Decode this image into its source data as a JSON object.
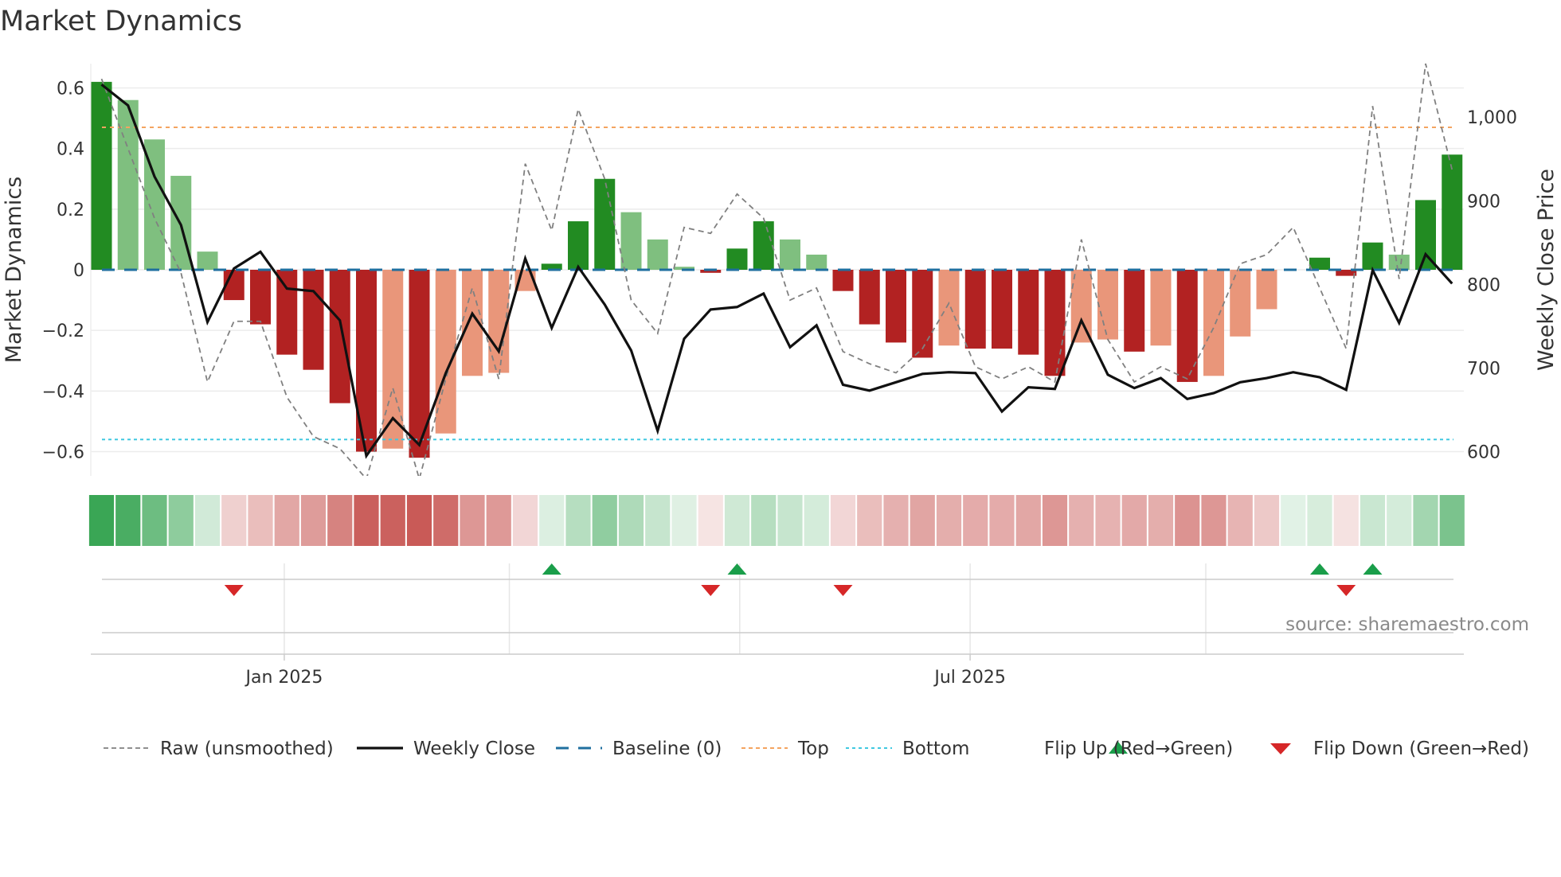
{
  "chart_data": {
    "type": "bar",
    "title": "Market Dynamics",
    "ylabel": "Market Dynamics",
    "y2label": "Weekly Close Price",
    "ylim": [
      -0.68,
      0.68
    ],
    "y2lim": [
      571,
      1064
    ],
    "yticks": [
      0.6,
      0.4,
      0.2,
      0,
      -0.2,
      -0.4,
      -0.6
    ],
    "ytick_labels": [
      "0.6",
      "0.4",
      "0.2",
      "0",
      "−0.2",
      "−0.4",
      "−0.6"
    ],
    "y2ticks": [
      1000,
      900,
      800,
      700,
      600
    ],
    "y2tick_labels": [
      "1,000",
      "900",
      "800",
      "700",
      "600"
    ],
    "xtick_labels": [
      {
        "label": "Jan 2025",
        "index": 6.9
      },
      {
        "label": "Jul 2025",
        "index": 32.8
      }
    ],
    "month_grid_indices": [
      6.9,
      15.4,
      24.1,
      32.8,
      41.7
    ],
    "dynamics": [
      0.62,
      0.56,
      0.43,
      0.31,
      0.06,
      -0.1,
      -0.18,
      -0.28,
      -0.33,
      -0.44,
      -0.6,
      -0.59,
      -0.62,
      -0.54,
      -0.35,
      -0.34,
      -0.07,
      0.02,
      0.16,
      0.3,
      0.19,
      0.1,
      0.01,
      -0.01,
      0.07,
      0.16,
      0.1,
      0.05,
      -0.07,
      -0.18,
      -0.24,
      -0.29,
      -0.25,
      -0.26,
      -0.26,
      -0.28,
      -0.35,
      -0.24,
      -0.23,
      -0.27,
      -0.25,
      -0.37,
      -0.35,
      -0.22,
      -0.13,
      0.0,
      0.04,
      -0.02,
      0.09,
      0.05,
      0.23,
      0.38
    ],
    "strength": [
      "S",
      "W",
      "W",
      "W",
      "W",
      "S",
      "S",
      "S",
      "S",
      "S",
      "S",
      "W",
      "S",
      "W",
      "W",
      "W",
      "W",
      "S",
      "S",
      "S",
      "W",
      "W",
      "W",
      "S",
      "S",
      "S",
      "W",
      "W",
      "S",
      "S",
      "S",
      "S",
      "W",
      "S",
      "S",
      "S",
      "S",
      "W",
      "W",
      "S",
      "W",
      "S",
      "W",
      "W",
      "W",
      "W",
      "S",
      "S",
      "S",
      "W",
      "S",
      "S"
    ],
    "raw": [
      0.63,
      0.4,
      0.17,
      -0.01,
      -0.37,
      -0.17,
      -0.17,
      -0.42,
      -0.55,
      -0.59,
      -0.69,
      -0.39,
      -0.69,
      -0.36,
      -0.06,
      -0.36,
      0.35,
      0.13,
      0.53,
      0.3,
      -0.1,
      -0.21,
      0.14,
      0.12,
      0.25,
      0.17,
      -0.1,
      -0.06,
      -0.27,
      -0.31,
      -0.34,
      -0.26,
      -0.11,
      -0.32,
      -0.36,
      -0.32,
      -0.37,
      0.1,
      -0.23,
      -0.37,
      -0.32,
      -0.36,
      -0.19,
      0.02,
      0.05,
      0.14,
      -0.06,
      -0.26,
      0.54,
      -0.03,
      0.68,
      0.33
    ],
    "weekly_close": [
      1039,
      1014,
      929,
      871,
      755,
      819,
      839,
      795,
      792,
      757,
      595,
      640,
      608,
      694,
      765,
      720,
      831,
      748,
      821,
      776,
      721,
      625,
      735,
      770,
      773,
      789,
      725,
      751,
      680,
      673,
      683,
      693,
      695,
      694,
      648,
      677,
      675,
      757,
      692,
      676,
      688,
      663,
      670,
      683,
      688,
      695,
      689,
      674,
      817,
      754,
      836,
      801
    ],
    "baseline": 0,
    "top": 0.47,
    "bottom": -0.56,
    "flip_up_indices": [
      17,
      24,
      46,
      48
    ],
    "flip_down_indices": [
      5,
      23,
      28,
      47
    ],
    "colors": {
      "strong_green": "#228b22",
      "weak_green": "#7fbf7f",
      "strong_red": "#b22222",
      "weak_red": "#e9967a",
      "baseline": "#1f6f9f",
      "top": "#f4a460",
      "bottom": "#40c8e0",
      "raw": "#808080",
      "close": "#111111",
      "flip_up": "#1a9e4a",
      "flip_down": "#d62728"
    },
    "legend": [
      {
        "label": "Raw (unsmoothed)",
        "kind": "raw"
      },
      {
        "label": "Weekly Close",
        "kind": "close"
      },
      {
        "label": "Baseline (0)",
        "kind": "baseline"
      },
      {
        "label": "Top",
        "kind": "top"
      },
      {
        "label": "Bottom",
        "kind": "bottom"
      },
      {
        "label": "Flip Up (Red→Green)",
        "kind": "flip_up"
      },
      {
        "label": "Flip Down (Green→Red)",
        "kind": "flip_down"
      }
    ],
    "source": "source: sharemaestro.com"
  }
}
